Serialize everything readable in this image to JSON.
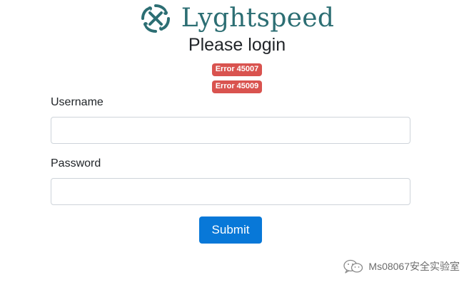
{
  "brand": {
    "name": "Lyghtspeed",
    "logo_icon": "knot-logo-icon",
    "color": "#2c6e73"
  },
  "title": "Please login",
  "errors": [
    "Error 45007",
    "Error 45009"
  ],
  "form": {
    "username": {
      "label": "Username",
      "value": ""
    },
    "password": {
      "label": "Password",
      "value": ""
    },
    "submit_label": "Submit"
  },
  "watermark": {
    "text": "Ms08067安全实验室",
    "icon": "wechat-icon"
  },
  "colors": {
    "error_badge": "#d9534f",
    "primary_button": "#0878d8",
    "input_border": "#ced4da"
  }
}
